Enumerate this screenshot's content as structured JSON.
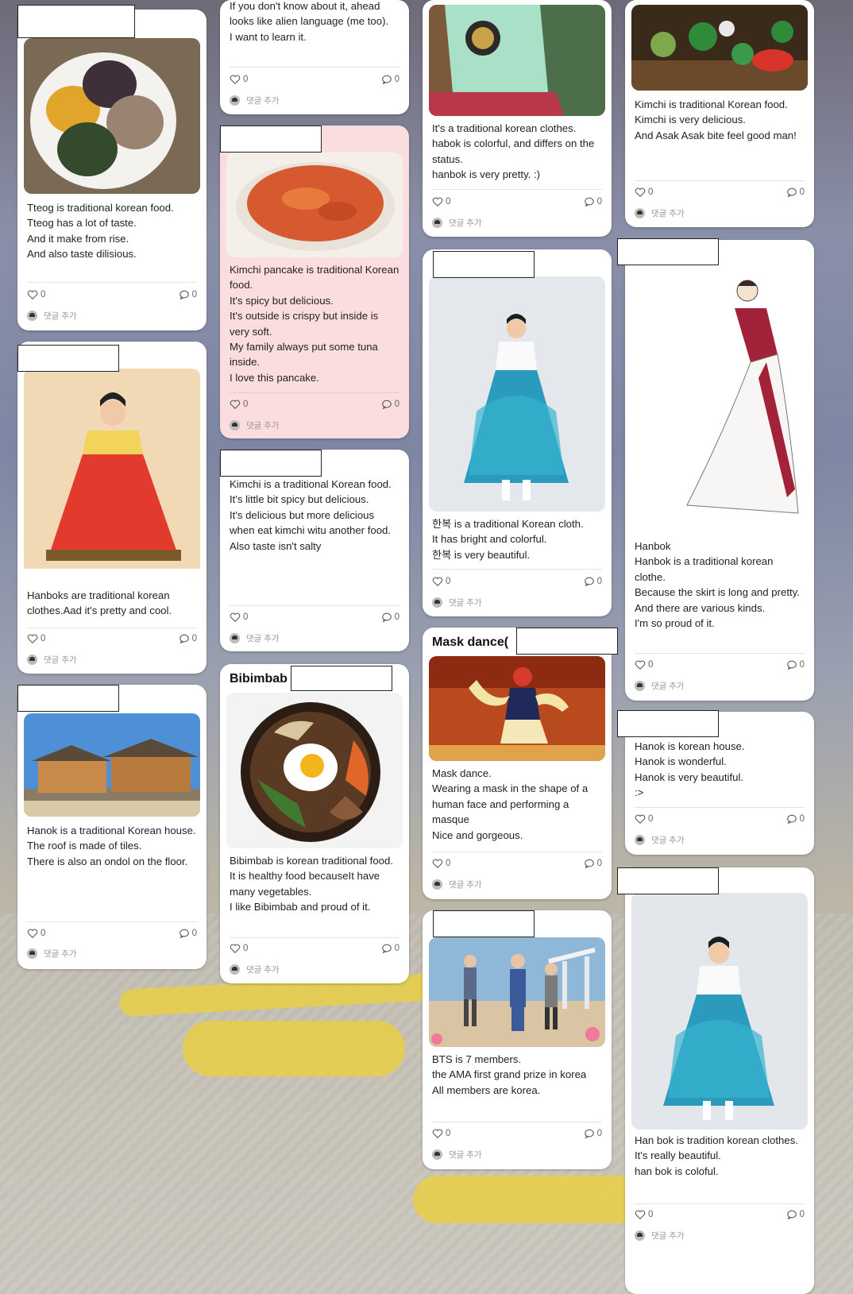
{
  "colors": {
    "card": "#ffffff",
    "pink_card": "#fbdde0",
    "text": "#222222",
    "muted": "#666666"
  },
  "comment_action": "댓글 추가",
  "like_count": "0",
  "comment_count": "0",
  "cards": [
    {
      "id": "tteog",
      "title": "",
      "body": "Tteog is traditional korean food.\nTteog has a lot of taste.\nAnd it make from rise.\nAnd also taste dilisious."
    },
    {
      "id": "hanbok-red",
      "title": "",
      "body": "Hanboks are traditional korean clothes.Aad it's pretty and cool."
    },
    {
      "id": "hanok-1",
      "title": "",
      "body": "Hanok is a traditional Korean house.\nThe roof is made of tiles.\nThere is also an ondol on the floor."
    },
    {
      "id": "alien",
      "title": "",
      "body": "If you don't know about it, ahead looks like alien language (me too).\nI want to learn it."
    },
    {
      "id": "kimchi-pancake",
      "title": "",
      "body": "Kimchi pancake is traditional Korean food.\nIt's spicy but delicious.\nIt's outside is crispy but inside is very soft.\nMy family always put some tuna inside.\nI love this pancake."
    },
    {
      "id": "kimchi-2",
      "title": "",
      "body": "Kimchi is a traditional Korean food.\nIt's little bit spicy but delicious.\nIt's delicious but more delicious when eat kimchi witu another food.\nAlso taste isn't salty"
    },
    {
      "id": "bibimbab",
      "title": "Bibimbab",
      "body": "Bibimbab is korean traditional food.\nIt is healthy food becauseIt have many vegetables.\nI like Bibimbab and proud of it."
    },
    {
      "id": "habok",
      "title": "",
      "body": "It's a traditional korean clothes.\nhabok is colorful, and differs on the status.\nhanbok is very pretty. :)"
    },
    {
      "id": "hanbok-blue",
      "title": "",
      "body": "한복 is a traditional Korean cloth.\nIt has bright and colorful.\n한복 is very beautiful."
    },
    {
      "id": "mask-dance",
      "title": "Mask dance(",
      "body": "Mask dance.\nWearing a mask in the shape of a human face and performing a masque\nNice and gorgeous."
    },
    {
      "id": "bts",
      "title": "",
      "body": "BTS is 7 members.\nthe AMA first grand prize in korea\nAll members are korea."
    },
    {
      "id": "kimchi-1",
      "title": "",
      "body": "Kimchi is traditional Korean food.\nKimchi is very delicious.\nAnd Asak Asak bite feel good man!"
    },
    {
      "id": "hanbok-drawing",
      "title": "",
      "body": "Hanbok\nHanbok is a traditional korean clothe.\nBecause the skirt is long and pretty.\nAnd there are various kinds.\nI'm so proud of it."
    },
    {
      "id": "hanok-2",
      "title": "",
      "body": "Hanok is korean house.\nHanok is wonderful.\nHanok is very beautiful.\n:>"
    },
    {
      "id": "hanbok-blue-2",
      "title": "",
      "body": "Han bok is tradition korean clothes.\nIt's really beautiful.\nhan bok is coloful."
    }
  ]
}
